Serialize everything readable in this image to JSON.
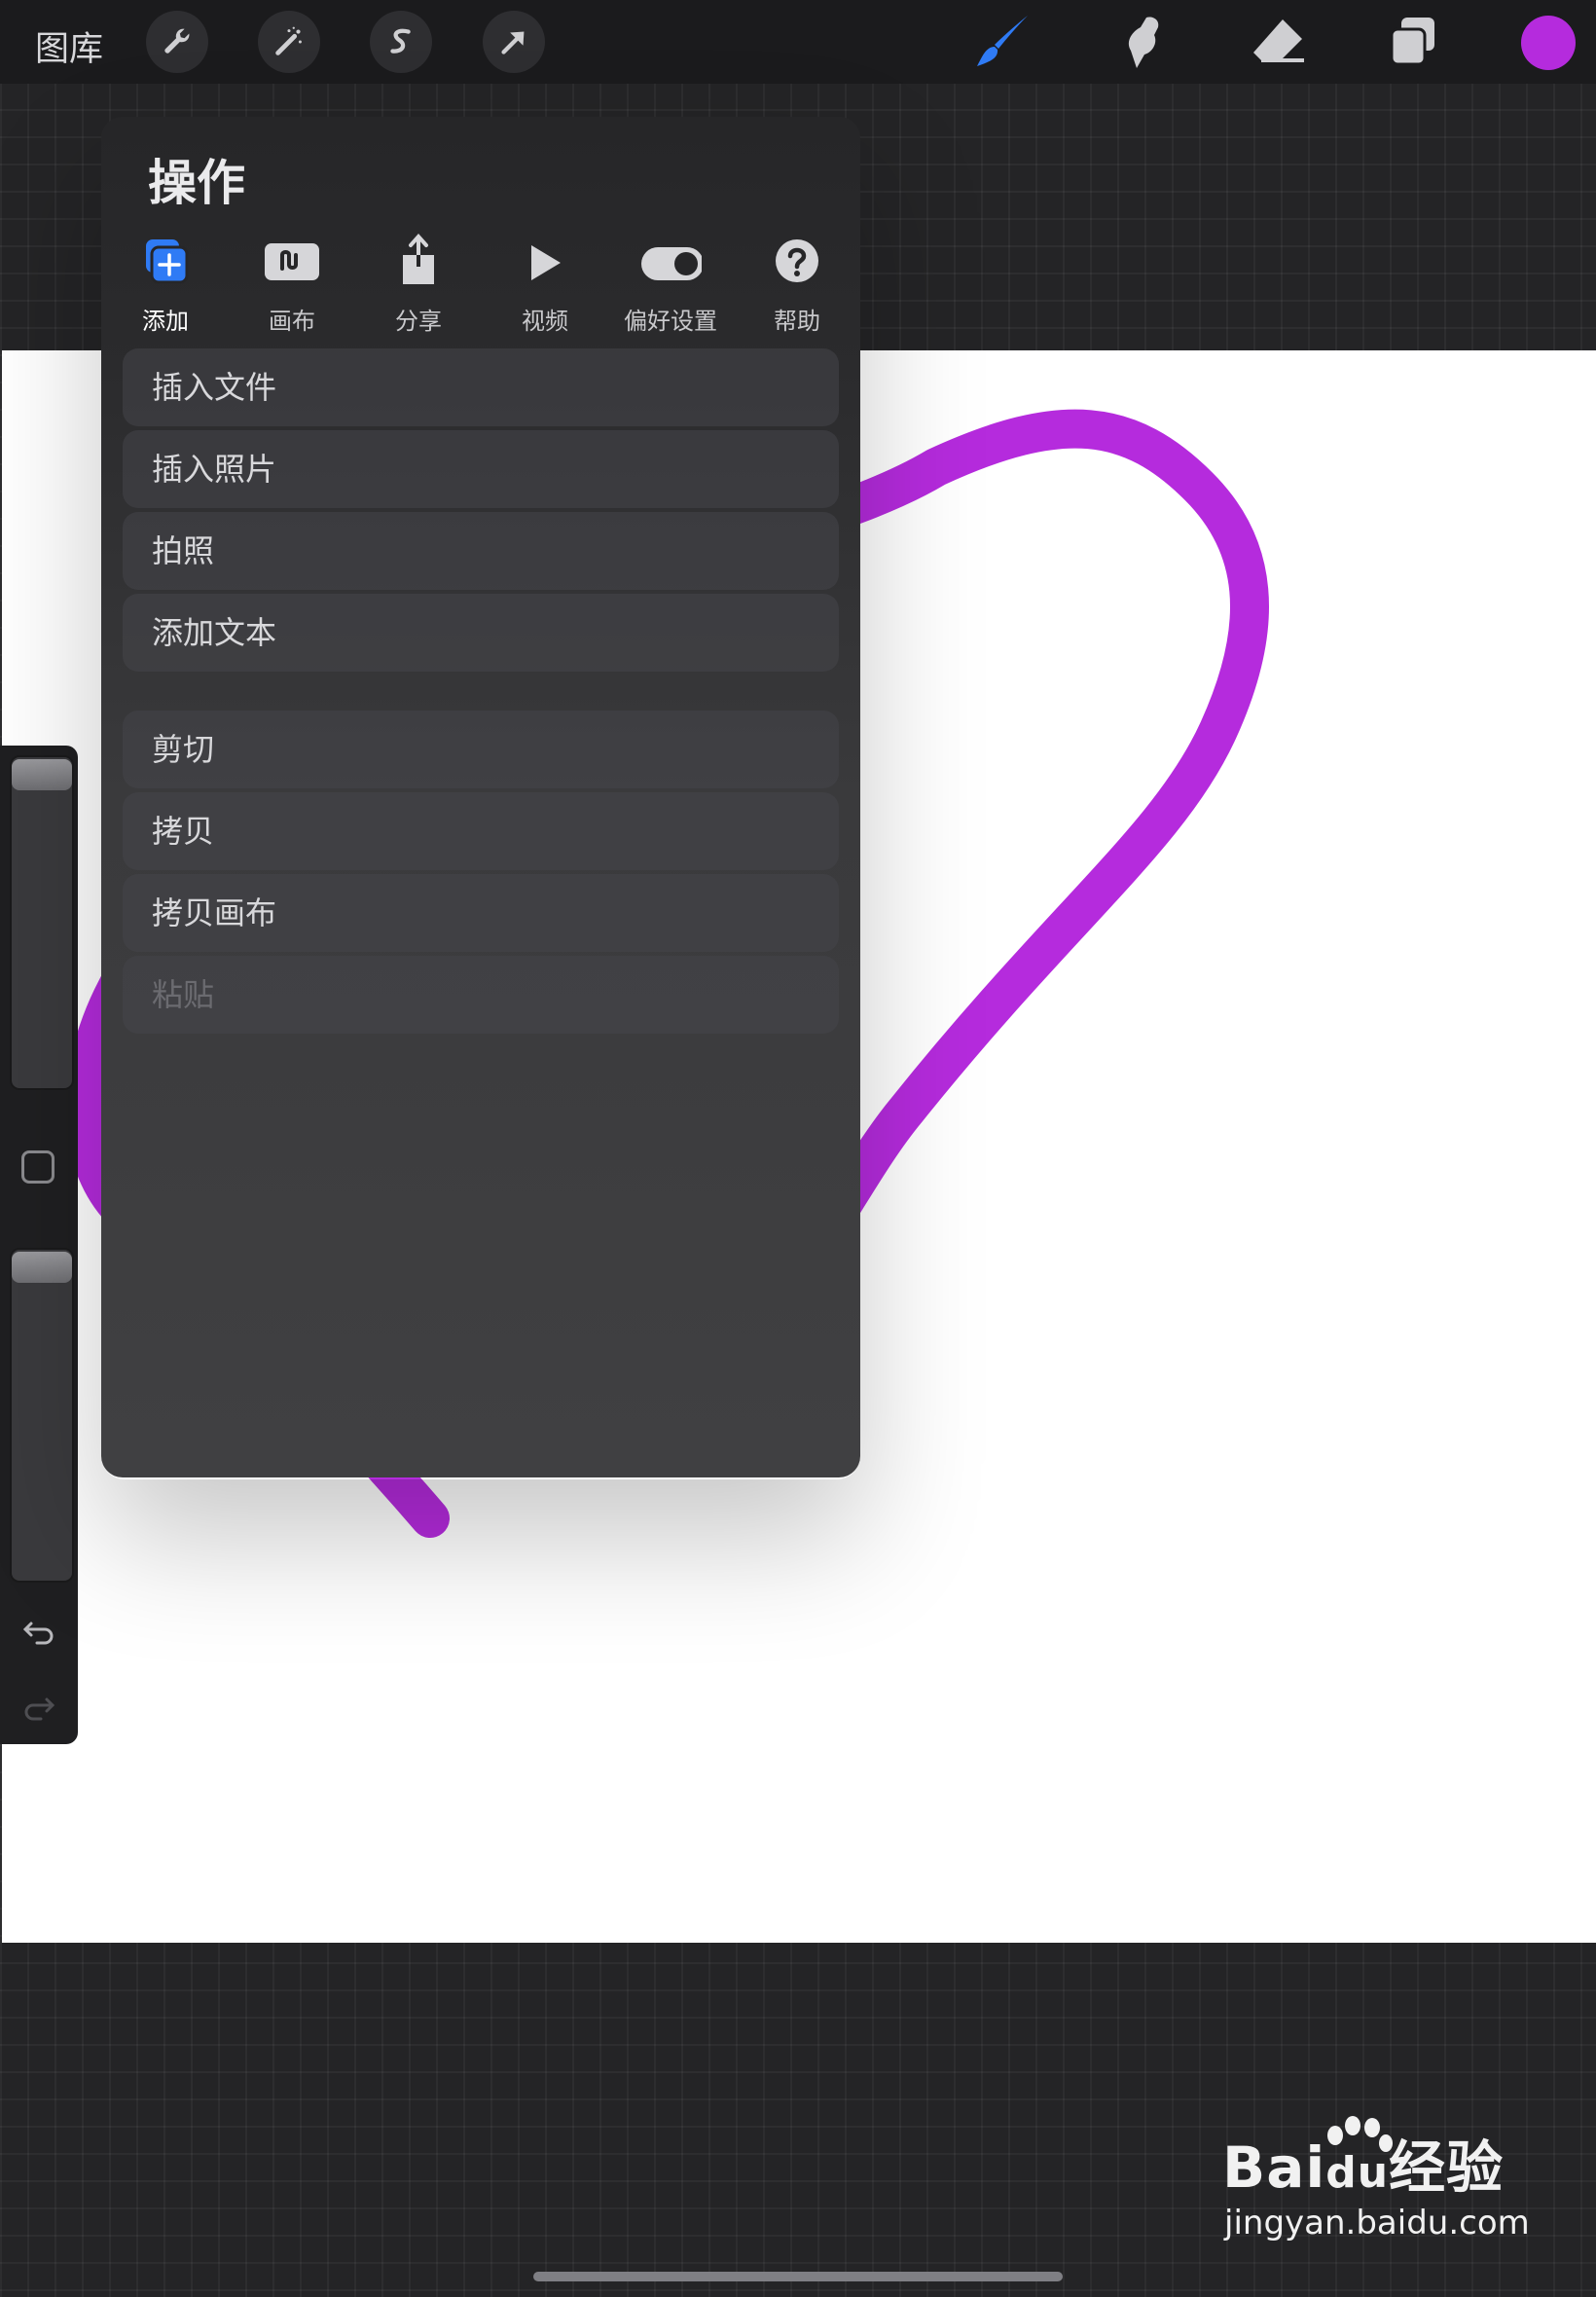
{
  "topbar": {
    "gallery_label": "图库",
    "left_tools": [
      "wrench-icon",
      "magic-wand-icon",
      "selection-s-icon",
      "arrow-transform-icon"
    ],
    "right_tools": [
      "brush-icon",
      "smudge-icon",
      "eraser-icon",
      "layers-icon"
    ],
    "current_color": "#b52bdd",
    "active_tool_color": "#2f7bf5"
  },
  "actions_panel": {
    "title": "操作",
    "tabs": [
      {
        "id": "add",
        "label": "添加",
        "icon": "add-layer-icon",
        "active": true
      },
      {
        "id": "canvas",
        "label": "画布",
        "icon": "canvas-icon",
        "active": false
      },
      {
        "id": "share",
        "label": "分享",
        "icon": "share-icon",
        "active": false
      },
      {
        "id": "video",
        "label": "视频",
        "icon": "play-icon",
        "active": false
      },
      {
        "id": "prefs",
        "label": "偏好设置",
        "icon": "toggle-icon",
        "active": false
      },
      {
        "id": "help",
        "label": "帮助",
        "icon": "help-icon",
        "active": false
      }
    ],
    "menu_group_1": [
      {
        "label": "插入文件",
        "enabled": true
      },
      {
        "label": "插入照片",
        "enabled": true
      },
      {
        "label": "拍照",
        "enabled": true
      },
      {
        "label": "添加文本",
        "enabled": true
      }
    ],
    "menu_group_2": [
      {
        "label": "剪切",
        "enabled": true
      },
      {
        "label": "拷贝",
        "enabled": true
      },
      {
        "label": "拷贝画布",
        "enabled": true
      },
      {
        "label": "粘贴",
        "enabled": false
      }
    ]
  },
  "canvas": {
    "stroke_color": "#b52bdd",
    "background": "#ffffff"
  },
  "sidebar": {
    "icons": [
      "brush-size-slider",
      "modify-button-icon",
      "opacity-slider",
      "undo-icon",
      "redo-icon"
    ]
  },
  "watermark": {
    "line1": "Bai",
    "line1_b": "du",
    "line1_c": "经验",
    "line2": "jingyan.baidu.com"
  }
}
